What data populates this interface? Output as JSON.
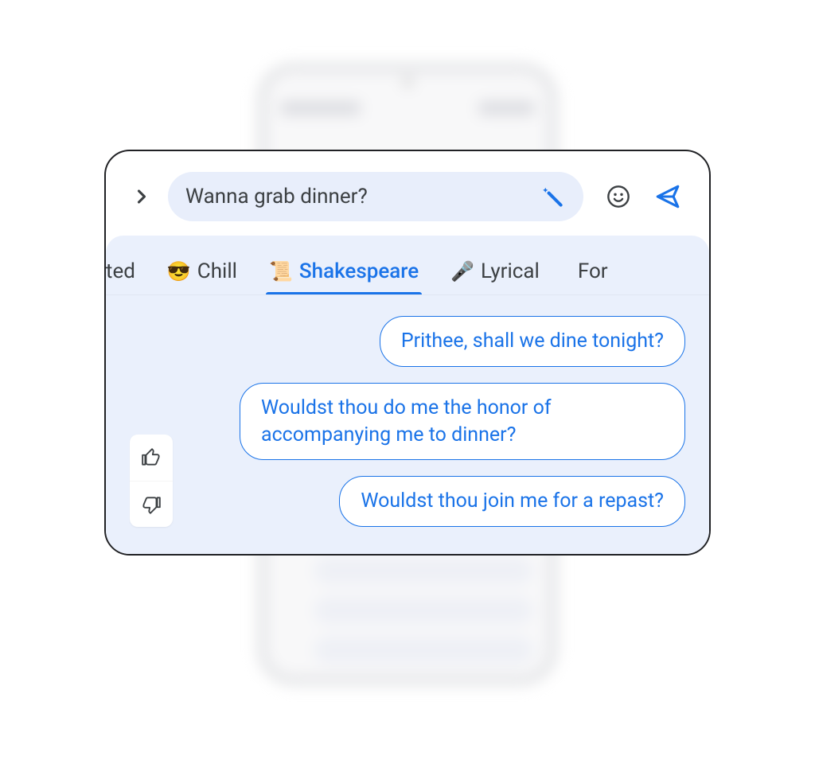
{
  "input": {
    "text": "Wanna grab dinner?"
  },
  "tabs": [
    {
      "emoji": "",
      "label": "cited",
      "active": false
    },
    {
      "emoji": "😎",
      "label": "Chill",
      "active": false
    },
    {
      "emoji": "📜",
      "label": "Shakespeare",
      "active": true
    },
    {
      "emoji": "🎤",
      "label": "Lyrical",
      "active": false
    },
    {
      "emoji": "",
      "label": "For",
      "active": false
    }
  ],
  "suggestions": [
    "Prithee, shall we dine tonight?",
    "Wouldst thou do me the honor of accompanying me to dinner?",
    "Wouldst thou join me for a repast?"
  ]
}
